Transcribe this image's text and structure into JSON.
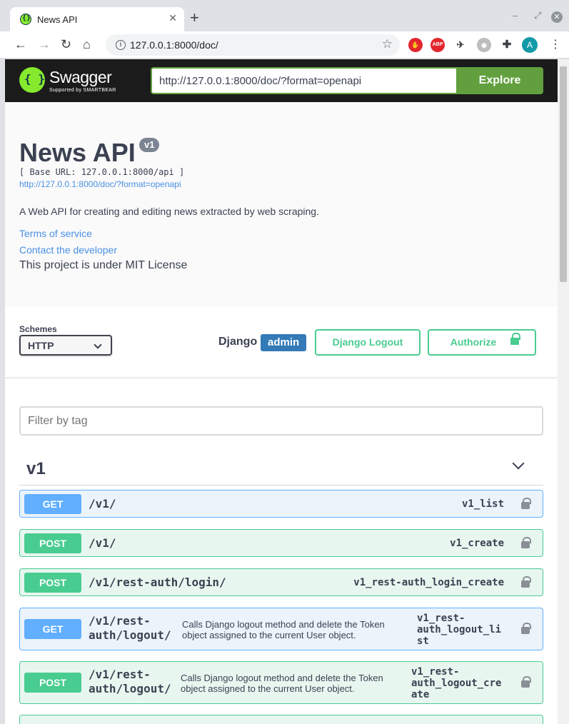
{
  "browser": {
    "tab_title": "News API",
    "tab_close": "✕",
    "new_tab": "+",
    "url": "127.0.0.1:8000/doc/",
    "profile_initial": "A",
    "ext_abp": "ABP"
  },
  "swagger": {
    "logo_text": "Swagger",
    "logo_sub": "Supported by SMARTBEAR",
    "explore_url": "http://127.0.0.1:8000/doc/?format=openapi",
    "explore_label": "Explore"
  },
  "info": {
    "title": "News API",
    "version": "v1",
    "base_url": "[ Base URL: 127.0.0.1:8000/api ]",
    "spec_url": "http://127.0.0.1:8000/doc/?format=openapi",
    "description": "A Web API for creating and editing news extracted by web scraping.",
    "terms_label": "Terms of service",
    "contact_label": "Contact the developer",
    "license_text": "This project is under MIT License"
  },
  "schemes": {
    "label": "Schemes",
    "selected": "HTTP",
    "django_label": "Django",
    "admin_label": "admin",
    "logout_label": "Django Logout",
    "authorize_label": "Authorize"
  },
  "filter": {
    "placeholder": "Filter by tag"
  },
  "tag": {
    "name": "v1"
  },
  "operations": [
    {
      "method": "GET",
      "path": "/v1/",
      "summary": "",
      "op_id": "v1_list"
    },
    {
      "method": "POST",
      "path": "/v1/",
      "summary": "",
      "op_id": "v1_create"
    },
    {
      "method": "POST",
      "path": "/v1/rest-auth/login/",
      "summary": "",
      "op_id": "v1_rest-auth_login_create"
    },
    {
      "method": "GET",
      "path_line1": "/v1/rest-",
      "path_line2": "auth/logout/",
      "summary_line1": "Calls Django logout method and delete the Token",
      "summary_line2": "object assigned to the current User object.",
      "op_id_line1": "v1_rest-",
      "op_id_line2": "auth_logout_li",
      "op_id_line3": "st"
    },
    {
      "method": "POST",
      "path_line1": "/v1/rest-",
      "path_line2": "auth/logout/",
      "summary_line1": "Calls Django logout method and delete the Token",
      "summary_line2": "object assigned to the current User object.",
      "op_id_line1": "v1_rest-",
      "op_id_line2": "auth_logout_cre",
      "op_id_line3": "ate"
    }
  ],
  "colors": {
    "get": "#61affe",
    "post": "#49cc90",
    "swagger_green": "#62a03f",
    "admin_blue": "#337ab7"
  }
}
